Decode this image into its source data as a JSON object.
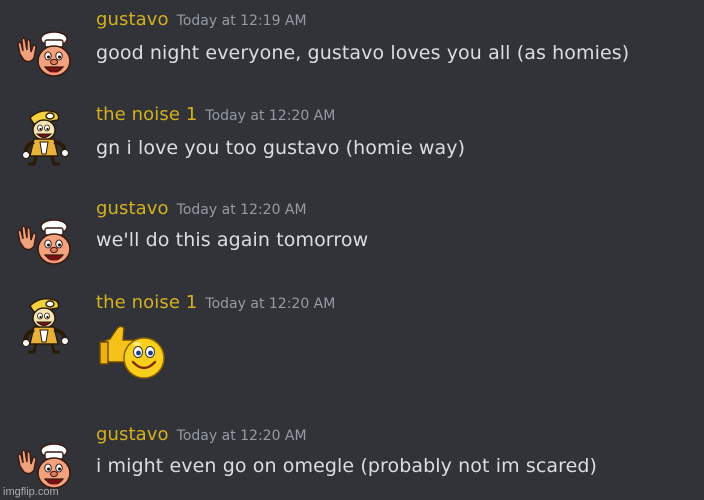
{
  "messages": [
    {
      "username": "gustavo",
      "timestamp": "Today at 12:19 AM",
      "text": "good night everyone, gustavo loves you all (as homies)",
      "avatar_icon": "chef-waving-icon"
    },
    {
      "username": "the noise 1",
      "timestamp": "Today at 12:20 AM",
      "text": "gn i love you too gustavo (homie way)",
      "avatar_icon": "noise-character-icon"
    },
    {
      "username": "gustavo",
      "timestamp": "Today at 12:20 AM",
      "text": "we'll do this again tomorrow",
      "avatar_icon": "chef-waving-icon"
    },
    {
      "username": "the noise 1",
      "timestamp": "Today at 12:20 AM",
      "text": "",
      "emoji": "thumbs-up-smiley-icon",
      "avatar_icon": "noise-character-icon"
    },
    {
      "username": "gustavo",
      "timestamp": "Today at 12:20 AM",
      "text": "i might even go on omegle (probably not im scared)",
      "avatar_icon": "chef-waving-icon"
    }
  ],
  "watermark": "imgflip.com",
  "colors": {
    "background": "#313338",
    "username": "#d4b11f",
    "timestamp": "#949ba4",
    "message_text": "#dbdee1"
  }
}
